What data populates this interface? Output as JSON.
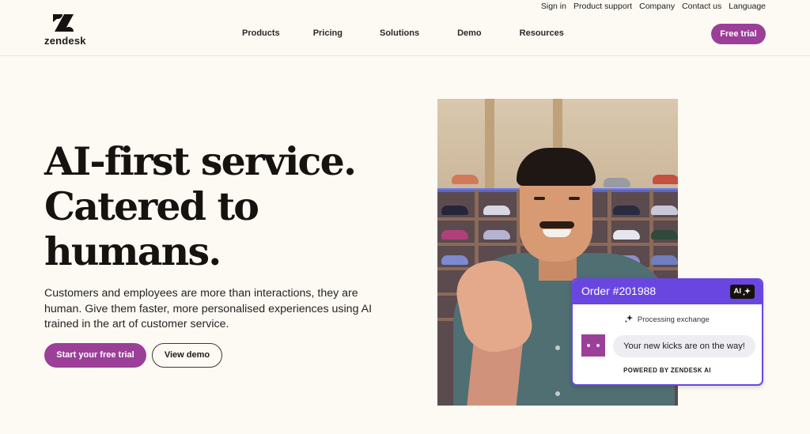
{
  "brand": {
    "name": "zendesk",
    "logo_icon": "zendesk-z-logo",
    "accent_color": "#9b3f98",
    "card_color": "#6a46e0",
    "background_color": "#fdf9f3"
  },
  "header": {
    "utility_links": [
      "Sign in",
      "Product support",
      "Company",
      "Contact us",
      "Language"
    ],
    "nav_items": [
      "Products",
      "Pricing",
      "Solutions",
      "Demo",
      "Resources"
    ],
    "cta_label": "Free trial"
  },
  "hero": {
    "headline_lines": [
      "AI-first service.",
      "Catered to",
      "humans."
    ],
    "subtext": "Customers and employees are more than interactions, they are human. Give them faster, more personalised experiences using AI trained in the art of customer service.",
    "primary_cta": "Start your free trial",
    "secondary_cta": "View demo",
    "image_description": "Smiling man making a finger heart gesture in front of a sneaker shelf"
  },
  "order_card": {
    "title": "Order #201988",
    "badge_label": "AI",
    "badge_icon": "sparkle-icon",
    "status_icon": "sparkle-icon",
    "status_text": "Processing exchange",
    "avatar_icon": "bot-face-icon",
    "message": "Your new kicks are on the way!",
    "footer": "POWERED BY ZENDESK AI"
  }
}
